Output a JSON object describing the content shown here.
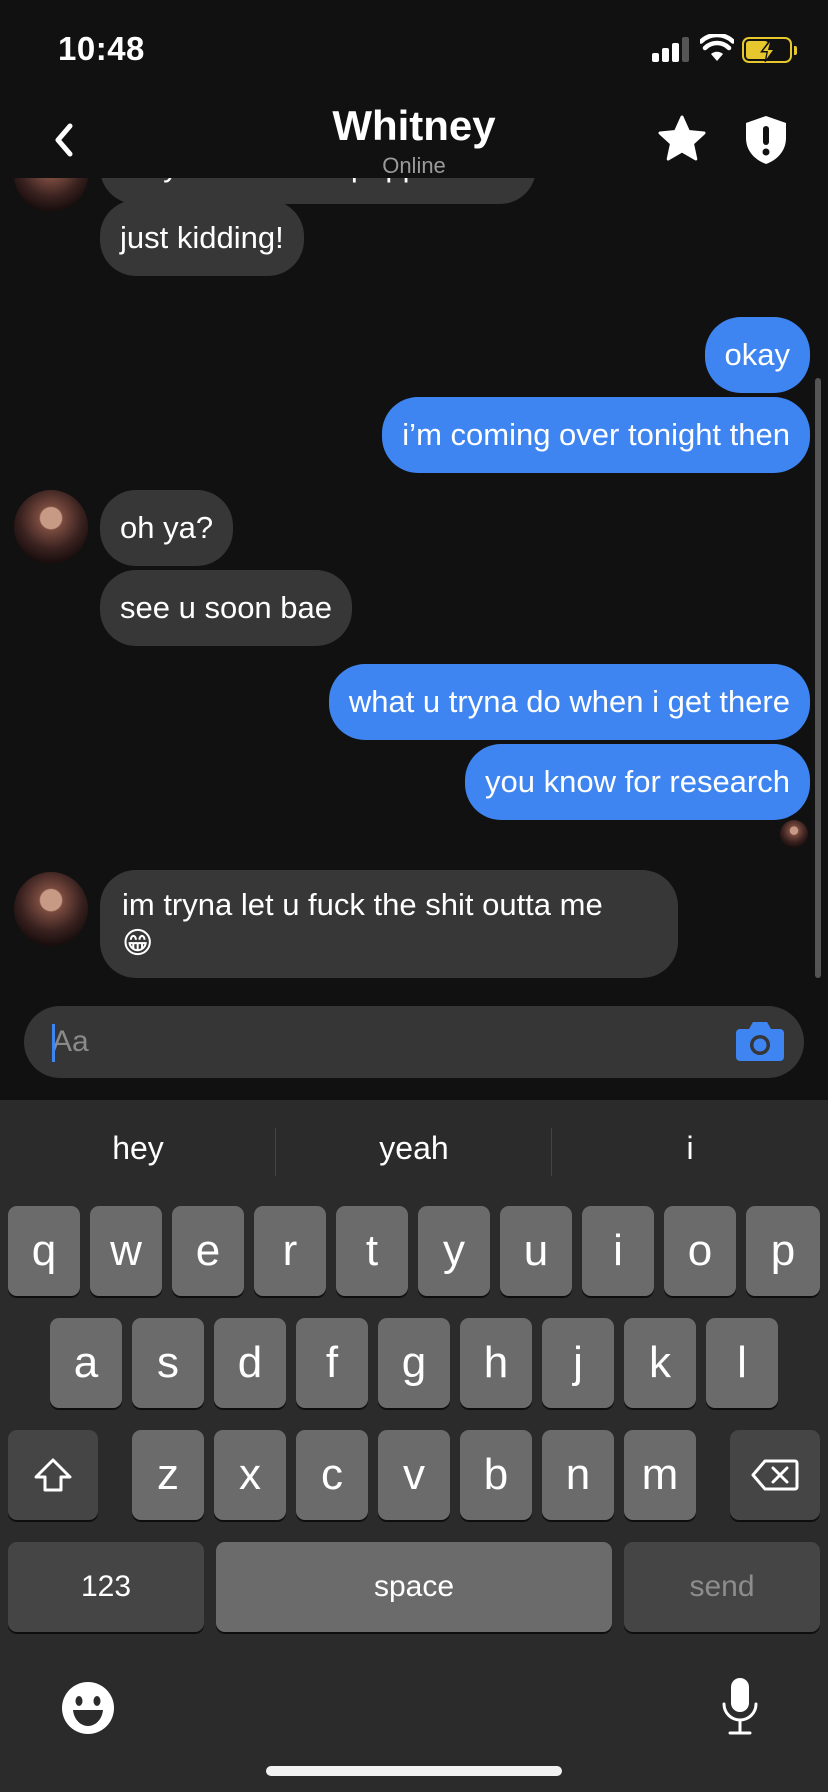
{
  "status_bar": {
    "time": "10:48"
  },
  "header": {
    "contact_name": "Whitney",
    "contact_status": "Online"
  },
  "messages": [
    {
      "from": "them",
      "text": "maybe like.. bell pepper hot?"
    },
    {
      "from": "them",
      "text": "just kidding!"
    },
    {
      "from": "me",
      "text": "okay"
    },
    {
      "from": "me",
      "text": "i’m coming over tonight then"
    },
    {
      "from": "them",
      "text": "oh ya?"
    },
    {
      "from": "them",
      "text": "see u soon bae"
    },
    {
      "from": "me",
      "text": "what u tryna do when i get there"
    },
    {
      "from": "me",
      "text": "you know for research"
    },
    {
      "from": "them",
      "text": "im tryna let u fuck the shit outta me",
      "emoji": "😁"
    }
  ],
  "composer": {
    "placeholder": "Aa"
  },
  "keyboard": {
    "suggestions": [
      "hey",
      "yeah",
      "i"
    ],
    "row1": [
      "q",
      "w",
      "e",
      "r",
      "t",
      "y",
      "u",
      "i",
      "o",
      "p"
    ],
    "row2": [
      "a",
      "s",
      "d",
      "f",
      "g",
      "h",
      "j",
      "k",
      "l"
    ],
    "row3": [
      "z",
      "x",
      "c",
      "v",
      "b",
      "n",
      "m"
    ],
    "numbers_label": "123",
    "space_label": "space",
    "send_label": "send"
  },
  "colors": {
    "outgoing_bubble": "#3f85f1",
    "incoming_bubble": "#373737",
    "background": "#111111"
  }
}
